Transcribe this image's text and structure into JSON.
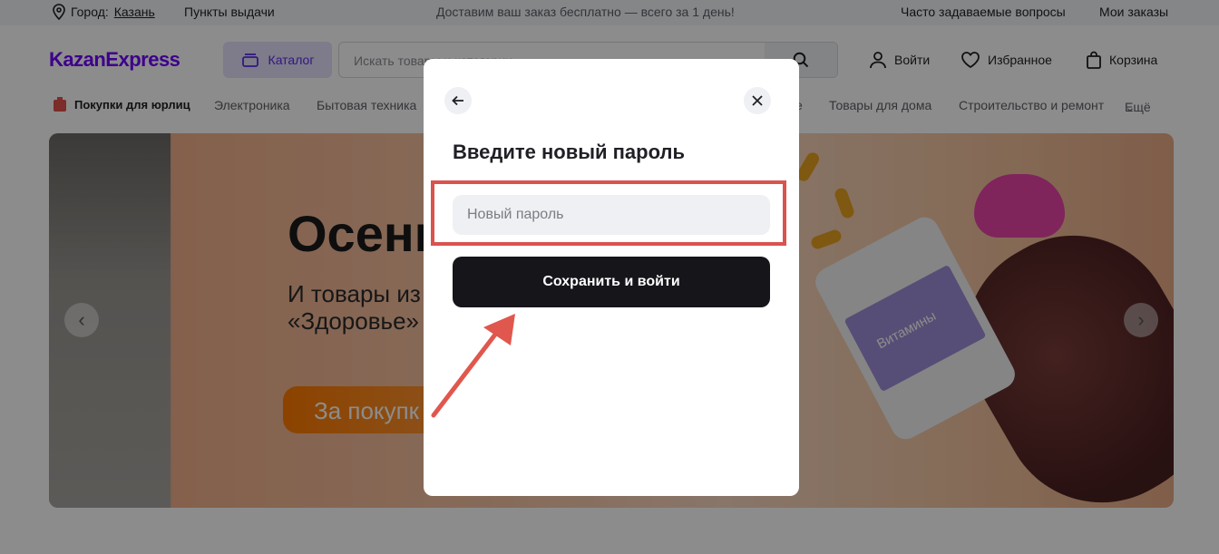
{
  "topbar": {
    "city_label": "Город:",
    "city_value": "Казань",
    "pickup_points": "Пункты выдачи",
    "promo": "Доставим ваш заказ бесплатно — всего за 1 день!",
    "faq": "Часто задаваемые вопросы",
    "my_orders": "Мои заказы"
  },
  "header": {
    "logo": "KazanExpress",
    "catalog_label": "Каталог",
    "search_placeholder": "Искать товары и категории",
    "login": "Войти",
    "favorites": "Избранное",
    "cart": "Корзина"
  },
  "categories": {
    "b2b": "Покупки для юрлиц",
    "items": [
      "Электроника",
      "Бытовая техника",
      "е",
      "Товары для дома",
      "Строительство и ремонт"
    ],
    "more": "Ещё"
  },
  "banner": {
    "headline": "Осенн",
    "subtitle": "И товары из\n«Здоровье»",
    "cta": "За покупк",
    "bottle_label": "Витамины"
  },
  "modal": {
    "title": "Введите новый пароль",
    "password_placeholder": "Новый пароль",
    "password_value": "",
    "submit_label": "Сохранить и войти"
  },
  "colors": {
    "brand": "#7000ff",
    "catalog_bg": "#e5e0fb",
    "button_dark": "#15151a",
    "annotation": "#d9534f"
  }
}
